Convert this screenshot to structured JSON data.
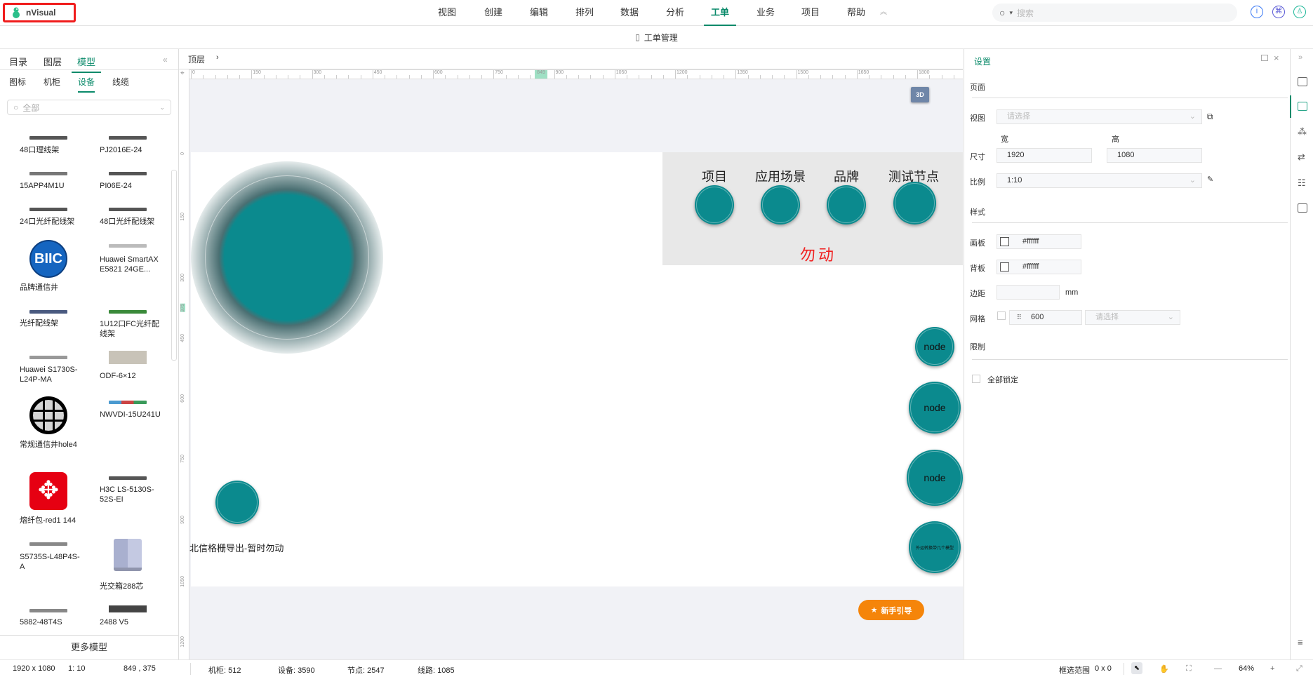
{
  "app": {
    "name": "nVisual"
  },
  "nav": {
    "items": [
      "视图",
      "创建",
      "编辑",
      "排列",
      "数据",
      "分析",
      "工单",
      "业务",
      "项目",
      "帮助"
    ],
    "active": "工单",
    "collapse_icon": "chevrons-up-icon"
  },
  "search": {
    "placeholder": "搜索"
  },
  "subbar": {
    "title": "工单管理"
  },
  "left": {
    "tabs": [
      "目录",
      "图层",
      "模型"
    ],
    "active_tab": "模型",
    "subtabs": [
      "图标",
      "机柜",
      "设备",
      "线缆"
    ],
    "active_subtab": "设备",
    "search_placeholder": "全部",
    "items": [
      "48口理线架",
      "PJ2016E-24",
      "15APP4M1U",
      "PI06E-24",
      "24口光纤配线架",
      "48口光纤配线架",
      "品牌通信井",
      "Huawei SmartAX E5821 24GE...",
      "光纤配线架",
      "1U12口FC光纤配线架",
      "Huawei S1730S-L24P-MA",
      "ODF-6×12",
      "常规通信井hole4",
      "NWVDI-15U241U",
      "熔纤包-red1 144",
      "H3C LS-5130S-52S-EI",
      "S5735S-L48P4S-A",
      "光交箱288芯",
      "5882-48T4S",
      "2488 V5"
    ],
    "biic_logo": "BIIC",
    "more_button": "更多模型"
  },
  "canvas": {
    "breadcrumb": "顶层",
    "ruler_h": [
      "0",
      "150",
      "300",
      "450",
      "600",
      "750",
      "849",
      "900",
      "1050",
      "1200",
      "1350",
      "1500",
      "1650",
      "1800"
    ],
    "ruler_v": [
      "0",
      "150",
      "300",
      "375",
      "450",
      "600",
      "750",
      "900",
      "1050",
      "1200"
    ],
    "button_3d": "3D",
    "legend_labels": [
      "项目",
      "应用场景",
      "品牌",
      "测试节点"
    ],
    "warning": "勿动",
    "nodes": [
      "node",
      "node",
      "node",
      "外运转换带几个模型"
    ],
    "export_text": "北信格栅导出-暂时勿动",
    "guide_button": "新手引导",
    "teal": "#0b8a8e",
    "accent": "#0a8a6a",
    "guide_color": "#f5850a"
  },
  "settings": {
    "title": "设置",
    "page_section": "页面",
    "view_label": "视图",
    "view_placeholder": "请选择",
    "width_label": "宽",
    "height_label": "高",
    "size_label": "尺寸",
    "width": "1920",
    "height": "1080",
    "scale_label": "比例",
    "scale": "1:10",
    "style_section": "样式",
    "board_label": "画板",
    "board_color": "#ffffff",
    "back_label": "背板",
    "back_color": "#ffffff",
    "margin_label": "边距",
    "margin_value": "",
    "margin_unit": "mm",
    "grid_label": "网格",
    "grid_value": "600",
    "grid_placeholder": "请选择",
    "limit_section": "限制",
    "lock_all": "全部锁定"
  },
  "status": {
    "page_size": "1920 x 1080",
    "scale": "1: 10",
    "cursor": "849 , 375",
    "cabinets": "机柜: 512",
    "devices": "设备: 3590",
    "nodes": "节点: 2547",
    "lines": "线路: 1085",
    "selection_label": "框选范围",
    "selection": "0 x 0",
    "zoom": "64%"
  }
}
